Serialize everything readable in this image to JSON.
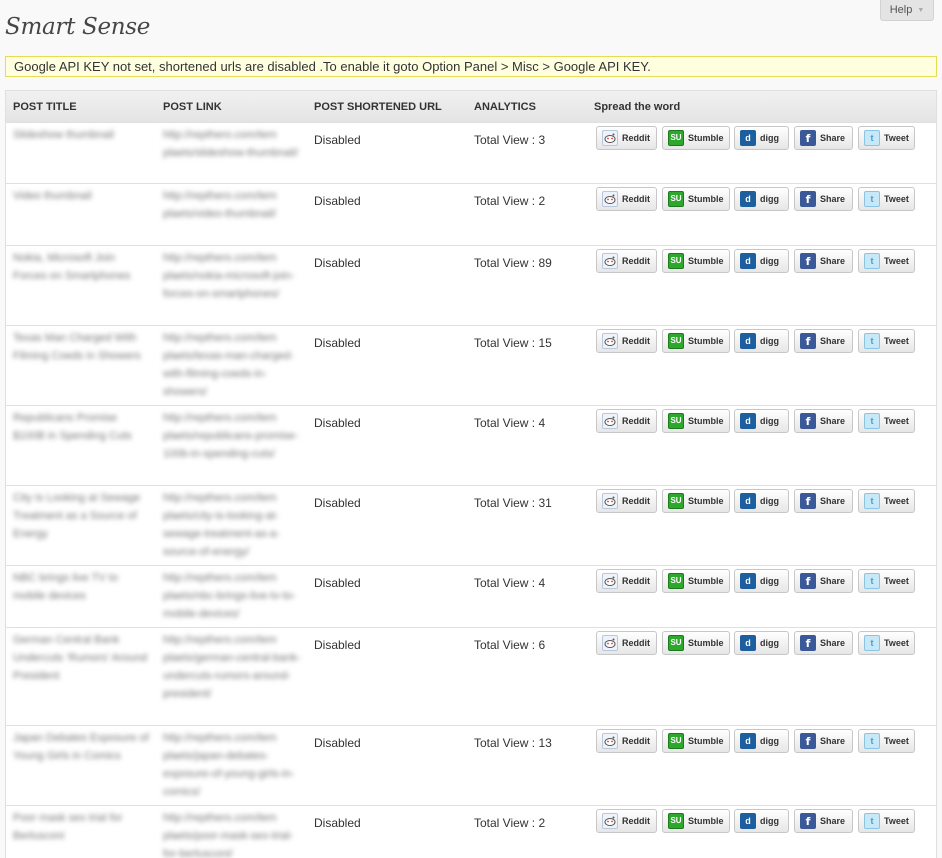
{
  "page": {
    "title": "Smart Sense",
    "help_label": "Help",
    "help_arrow": "▼"
  },
  "notice": "Google API KEY not set, shortened urls are disabled .To enable it goto Option Panel > Misc > Google API KEY.",
  "table": {
    "headers": [
      "POST TITLE",
      "POST LINK",
      "POST SHORTENED URL",
      "ANALYTICS",
      "Spread the word"
    ],
    "share_buttons": [
      "Reddit",
      "Stumble",
      "digg",
      "Share",
      "Tweet"
    ],
    "rows": [
      {
        "title": "Slideshow thumbnail",
        "link": "http://repthero.com/tem plaets/slideshow-thumbnail/",
        "short_url": "Disabled",
        "analytics": "Total View : 3"
      },
      {
        "title": "Video thumbnail",
        "link": "http://repthero.com/tem plaets/video-thumbnail/",
        "short_url": "Disabled",
        "analytics": "Total View : 2"
      },
      {
        "title": "Nokia, Microsoft Join Forces on Smartphones",
        "link": "http://repthero.com/tem plaets/nokia-microsoft-join-forces-on-smartphones/",
        "short_url": "Disabled",
        "analytics": "Total View : 89"
      },
      {
        "title": "Texas Man Charged With Filming Coeds in Showers",
        "link": "http://repthero.com/tem plaets/texas-man-charged-with-filming-coeds-in-showers/",
        "short_url": "Disabled",
        "analytics": "Total View : 15"
      },
      {
        "title": "Republicans Promise $100B in Spending Cuts",
        "link": "http://repthero.com/tem plaets/republicans-promise-100b-in-spending-cuts/",
        "short_url": "Disabled",
        "analytics": "Total View : 4"
      },
      {
        "title": "City Is Looking at Sewage Treatment as a Source of Energy",
        "link": "http://repthero.com/tem plaets/city-is-looking-at-sewage-treatment-as-a-source-of-energy/",
        "short_url": "Disabled",
        "analytics": "Total View : 31"
      },
      {
        "title": "NBC brings live TV to mobile devices",
        "link": "http://repthero.com/tem plaets/nbc-brings-live-tv-to-mobile-devices/",
        "short_url": "Disabled",
        "analytics": "Total View : 4"
      },
      {
        "title": "German Central Bank Undercuts ‘Rumors’ Around President",
        "link": "http://repthero.com/tem plaets/german-central-bank-undercuts-rumors-around-president/",
        "short_url": "Disabled",
        "analytics": "Total View : 6"
      },
      {
        "title": "Japan Debates Exposure of Young Girls in Comics",
        "link": "http://repthero.com/tem plaets/japan-debates-exposure-of-young-girls-in-comics/",
        "short_url": "Disabled",
        "analytics": "Total View : 13"
      },
      {
        "title": "Poor mask sex trial for Berlusconi",
        "link": "http://repthero.com/tem plaets/poor-mask-sex-trial-for-berlusconi/",
        "short_url": "Disabled",
        "analytics": "Total View : 2"
      }
    ]
  },
  "icons": {
    "reddit": "reddit-icon",
    "stumble": "stumbleupon-icon",
    "digg": "digg-icon",
    "share": "facebook-icon",
    "tweet": "twitter-icon"
  },
  "colors": {
    "notice_bg": "#ffffe0",
    "notice_border": "#e6db55",
    "header_bg": "#ececec"
  }
}
